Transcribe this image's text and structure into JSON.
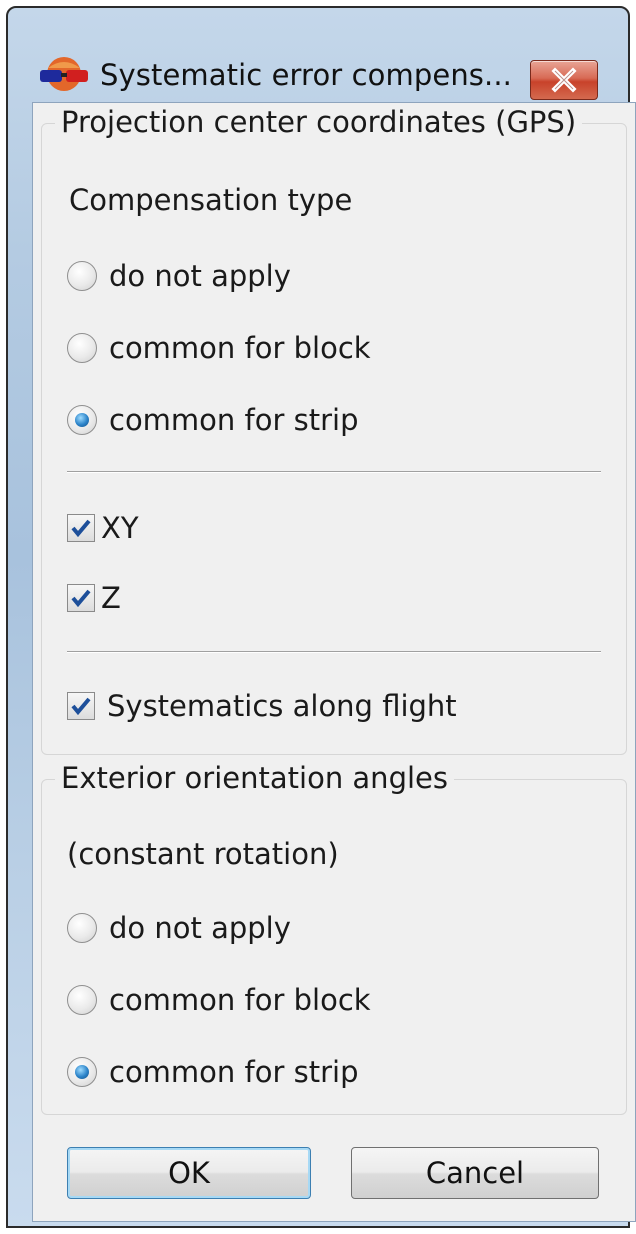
{
  "window": {
    "title": "Systematic error compens...",
    "icon": "stereo-glasses-globe-icon",
    "close_icon": "close-icon"
  },
  "gps_group": {
    "legend": "Projection center coordinates (GPS)",
    "compensation_type_label": "Compensation type",
    "options": [
      {
        "label": "do not apply",
        "checked": false
      },
      {
        "label": "common for block",
        "checked": false
      },
      {
        "label": "common for strip",
        "checked": true
      }
    ],
    "checkboxes": [
      {
        "label": "XY",
        "checked": true
      },
      {
        "label": "Z",
        "checked": true
      },
      {
        "label": "Systematics along flight",
        "checked": true
      }
    ]
  },
  "angles_group": {
    "legend": "Exterior orientation angles",
    "sub_label": "(constant rotation)",
    "options": [
      {
        "label": "do not apply",
        "checked": false
      },
      {
        "label": "common for block",
        "checked": false
      },
      {
        "label": "common for strip",
        "checked": true
      }
    ]
  },
  "buttons": {
    "ok": "OK",
    "cancel": "Cancel"
  },
  "colors": {
    "accent": "#2b83c9",
    "close_button": "#c8422a",
    "check_mark": "#1d4f9a"
  }
}
